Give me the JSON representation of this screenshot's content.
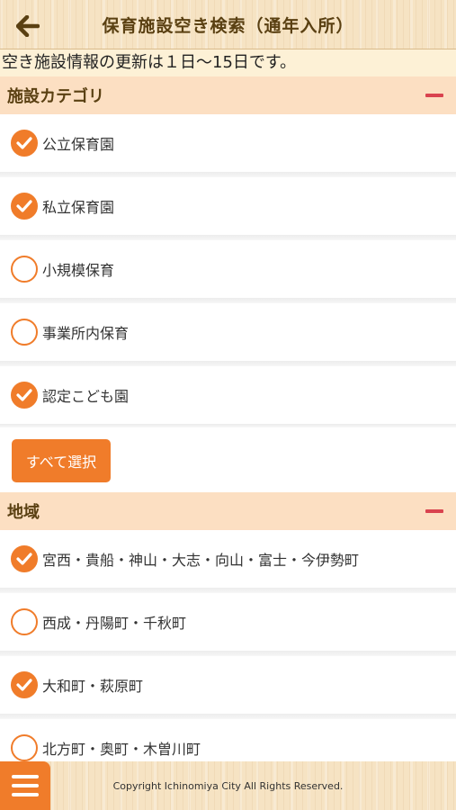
{
  "header": {
    "title": "保育施設空き検索（通年入所）",
    "back_icon": "arrow-left-icon"
  },
  "notice": "空き施設情報の更新は１日〜15日です。",
  "category": {
    "title": "施設カテゴリ",
    "items": [
      {
        "label": "公立保育園",
        "checked": true
      },
      {
        "label": "私立保育園",
        "checked": true
      },
      {
        "label": "小規模保育",
        "checked": false
      },
      {
        "label": "事業所内保育",
        "checked": false
      },
      {
        "label": "認定こども園",
        "checked": true
      }
    ],
    "select_all_label": "すべて選択"
  },
  "region": {
    "title": "地域",
    "items": [
      {
        "label": "宮西・貴船・神山・大志・向山・富士・今伊勢町",
        "checked": true
      },
      {
        "label": "西成・丹陽町・千秋町",
        "checked": false
      },
      {
        "label": "大和町・萩原町",
        "checked": true
      },
      {
        "label": "北方町・奥町・木曽川町",
        "checked": false
      }
    ]
  },
  "footer": {
    "copyright": "Copyright Ichinomiya City All Rights Reserved."
  },
  "colors": {
    "accent": "#f07c2a",
    "section_bg": "#fcdfc2",
    "minus": "#d9434f",
    "title": "#5a4012"
  }
}
